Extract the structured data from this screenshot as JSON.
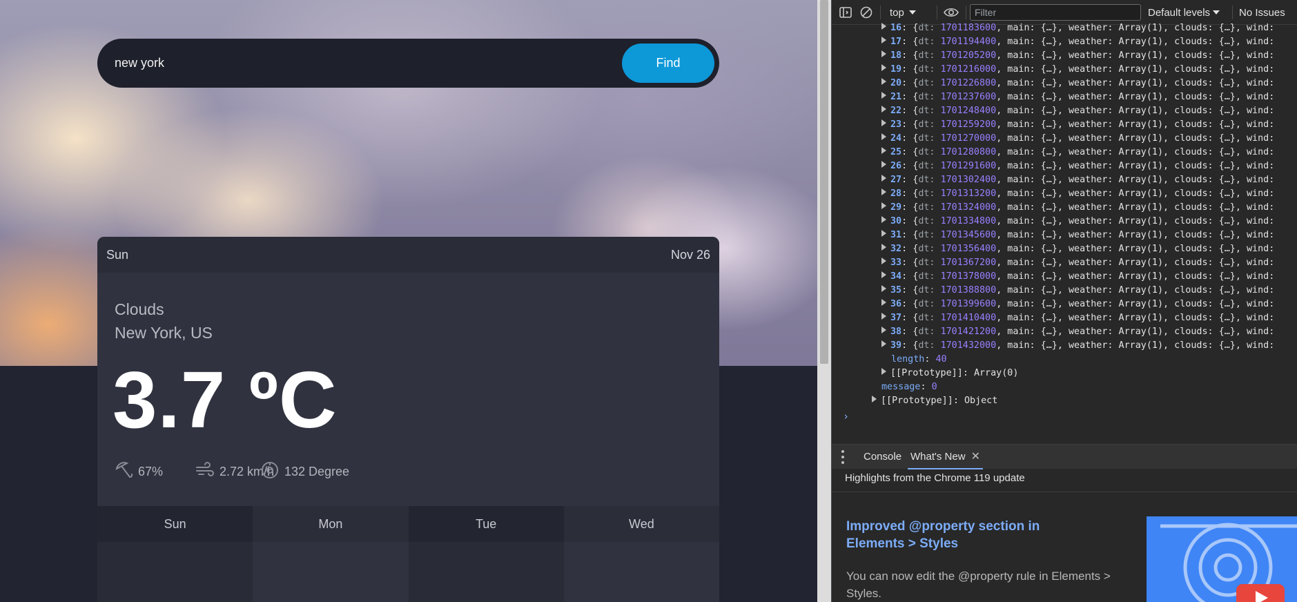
{
  "weather_app": {
    "search": {
      "value": "new york",
      "find_label": "Find"
    },
    "card": {
      "day": "Sun",
      "date": "Nov 26",
      "condition": "Clouds",
      "location": "New York, US",
      "temperature": "3.7 ºC",
      "humidity": "67%",
      "wind": "2.72 km/h",
      "direction": "132 Degree"
    },
    "forecast_days": [
      "Sun",
      "Mon",
      "Tue",
      "Wed"
    ]
  },
  "devtools": {
    "toolbar": {
      "context": "top",
      "filter_placeholder": "Filter",
      "levels": "Default levels",
      "issues": "No Issues"
    },
    "console": {
      "entries": [
        {
          "index": "16",
          "dt": "1701183600"
        },
        {
          "index": "17",
          "dt": "1701194400"
        },
        {
          "index": "18",
          "dt": "1701205200"
        },
        {
          "index": "19",
          "dt": "1701216000"
        },
        {
          "index": "20",
          "dt": "1701226800"
        },
        {
          "index": "21",
          "dt": "1701237600"
        },
        {
          "index": "22",
          "dt": "1701248400"
        },
        {
          "index": "23",
          "dt": "1701259200"
        },
        {
          "index": "24",
          "dt": "1701270000"
        },
        {
          "index": "25",
          "dt": "1701280800"
        },
        {
          "index": "26",
          "dt": "1701291600"
        },
        {
          "index": "27",
          "dt": "1701302400"
        },
        {
          "index": "28",
          "dt": "1701313200"
        },
        {
          "index": "29",
          "dt": "1701324000"
        },
        {
          "index": "30",
          "dt": "1701334800"
        },
        {
          "index": "31",
          "dt": "1701345600"
        },
        {
          "index": "32",
          "dt": "1701356400"
        },
        {
          "index": "33",
          "dt": "1701367200"
        },
        {
          "index": "34",
          "dt": "1701378000"
        },
        {
          "index": "35",
          "dt": "1701388800"
        },
        {
          "index": "36",
          "dt": "1701399600"
        },
        {
          "index": "37",
          "dt": "1701410400"
        },
        {
          "index": "38",
          "dt": "1701421200"
        },
        {
          "index": "39",
          "dt": "1701432000"
        }
      ],
      "entry_rest": ", main: {…}, weather: Array(1), clouds: {…}, wind:",
      "length_key": "length",
      "length_value": "40",
      "array_proto": "[[Prototype]]",
      "array_proto_value": "Array(0)",
      "message_key": "message",
      "message_value": "0",
      "object_proto": "[[Prototype]]",
      "object_proto_value": "Object",
      "prompt": "›"
    },
    "drawer": {
      "tabs": [
        "Console",
        "What's New"
      ],
      "close": "✕",
      "highlights": "Highlights from the Chrome 119 update",
      "feature_title": "Improved @property section in Elements > Styles",
      "feature_desc": "You can now edit the @property rule in Elements > Styles."
    }
  },
  "colors": {
    "accent": "#0d98d8",
    "devtools_link": "#7cacf8",
    "devtools_number": "#9980ff",
    "card_bg": "#30333f"
  }
}
